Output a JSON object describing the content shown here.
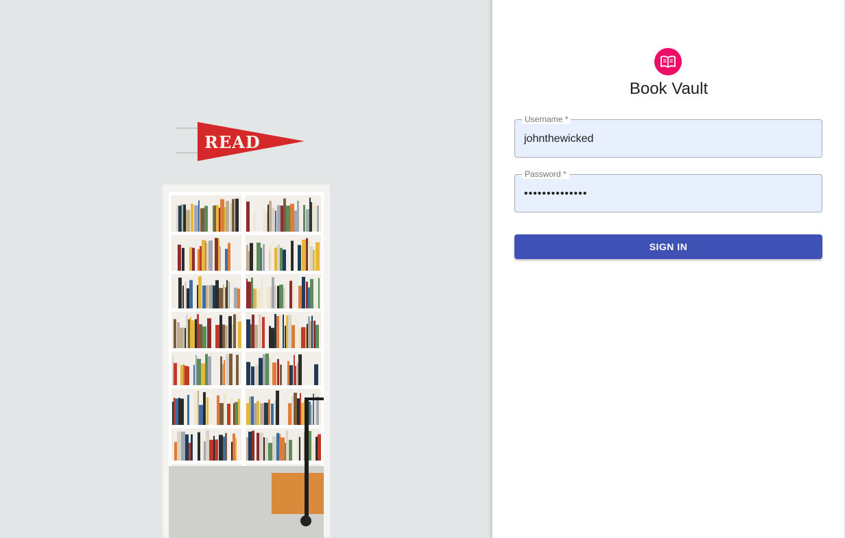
{
  "hero": {
    "pennant_text": "READ",
    "wall_color": "#e3e6e7",
    "pennant_color": "#d4282a"
  },
  "login": {
    "logo_icon": "book-open-icon",
    "logo_color": "#ec0e66",
    "app_title": "Book Vault",
    "username": {
      "label": "Username *",
      "value": "johnthewicked"
    },
    "password": {
      "label": "Password *",
      "value": "••••••••••••••"
    },
    "sign_in_label": "SIGN IN",
    "button_color": "#3f51b5",
    "autofill_bg": "#e8f0fd"
  }
}
